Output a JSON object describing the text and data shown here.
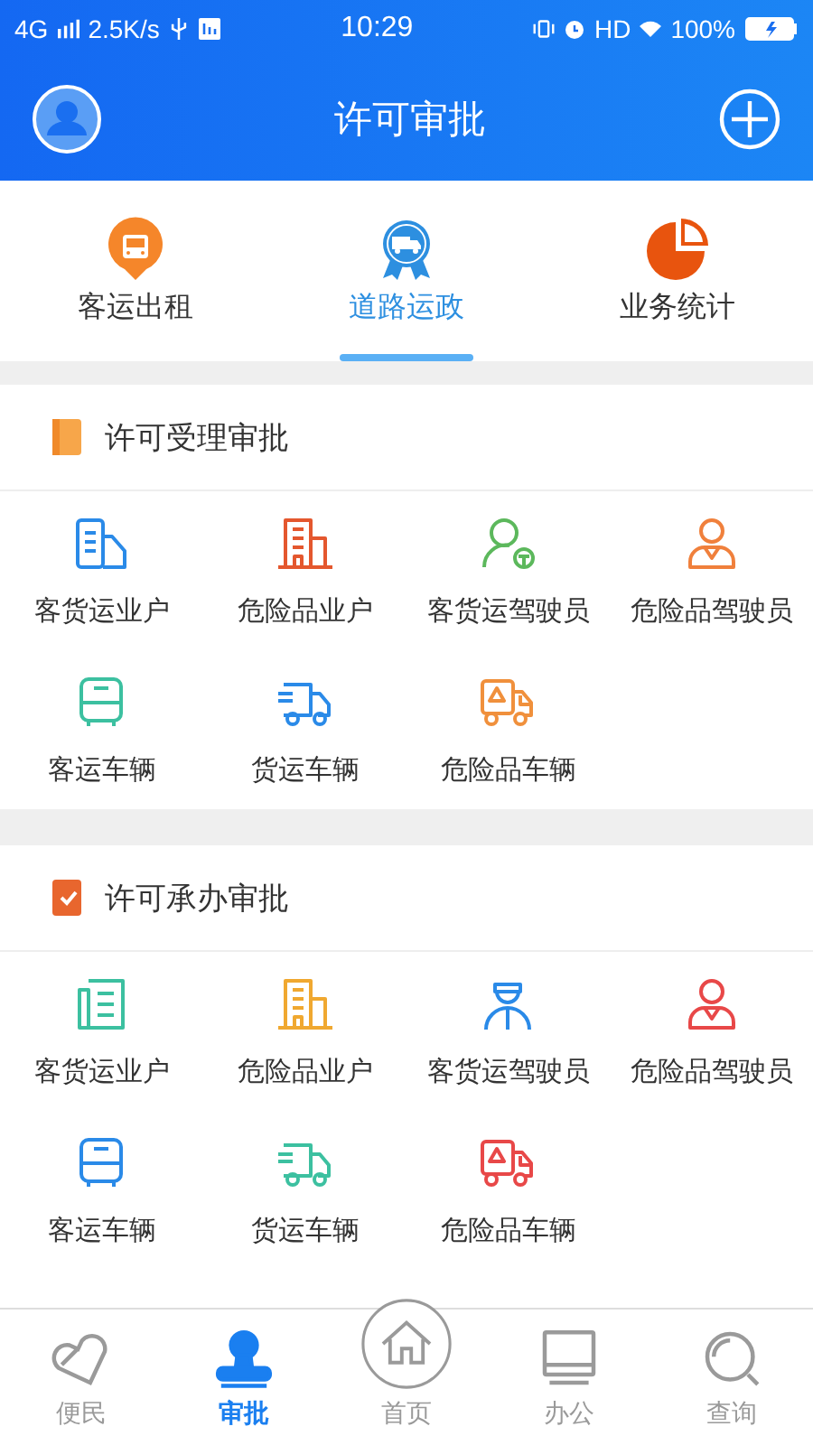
{
  "status_bar": {
    "network": "4G",
    "speed": "2.5K/s",
    "time": "10:29",
    "hd": "HD",
    "battery": "100%"
  },
  "header": {
    "title": "许可审批"
  },
  "tabs": [
    {
      "label": "客运出租",
      "kind": "bus-pin",
      "selected": false
    },
    {
      "label": "道路运政",
      "kind": "truck-badge",
      "selected": true
    },
    {
      "label": "业务统计",
      "kind": "pie",
      "selected": false
    }
  ],
  "sections": [
    {
      "title": "许可受理审批",
      "items": [
        {
          "label": "客货运业户",
          "kind": "office",
          "color": "#2a8ae8"
        },
        {
          "label": "危险品业户",
          "kind": "building",
          "color": "#e4572e"
        },
        {
          "label": "客货运驾驶员",
          "kind": "driver",
          "color": "#5cb85c"
        },
        {
          "label": "危险品驾驶员",
          "kind": "person",
          "color": "#f0803c"
        },
        {
          "label": "客运车辆",
          "kind": "bus",
          "color": "#3cc0a0"
        },
        {
          "label": "货运车辆",
          "kind": "truck",
          "color": "#2a8ae8"
        },
        {
          "label": "危险品车辆",
          "kind": "hazard-truck",
          "color": "#f0903c"
        }
      ]
    },
    {
      "title": "许可承办审批",
      "items": [
        {
          "label": "客货运业户",
          "kind": "doc",
          "color": "#3cc0a0"
        },
        {
          "label": "危险品业户",
          "kind": "building",
          "color": "#f0a830"
        },
        {
          "label": "客货运驾驶员",
          "kind": "officer",
          "color": "#2a8ae8"
        },
        {
          "label": "危险品驾驶员",
          "kind": "person",
          "color": "#e84848"
        },
        {
          "label": "客运车辆",
          "kind": "bus",
          "color": "#2a8ae8"
        },
        {
          "label": "货运车辆",
          "kind": "truck",
          "color": "#3cc0a0"
        },
        {
          "label": "危险品车辆",
          "kind": "hazard-truck",
          "color": "#e84848"
        }
      ]
    }
  ],
  "bottom_nav": [
    {
      "label": "便民",
      "kind": "heart",
      "selected": false
    },
    {
      "label": "审批",
      "kind": "stamp",
      "selected": true
    },
    {
      "label": "首页",
      "kind": "home",
      "selected": false
    },
    {
      "label": "办公",
      "kind": "monitor",
      "selected": false
    },
    {
      "label": "查询",
      "kind": "search",
      "selected": false
    }
  ]
}
